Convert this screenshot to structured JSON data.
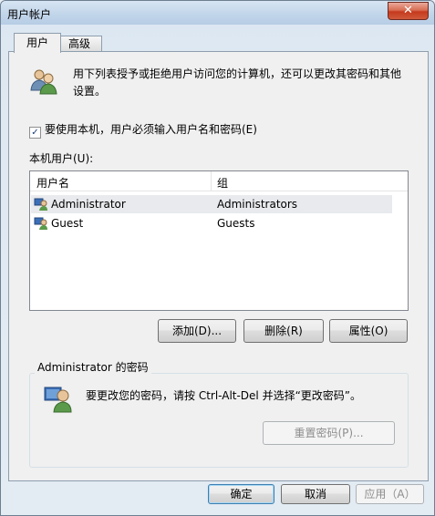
{
  "window": {
    "title": "用户帐户",
    "close_label": "✕"
  },
  "tabs": [
    {
      "label": "用户"
    },
    {
      "label": "高级"
    }
  ],
  "intro_text": "用下列表授予或拒绝用户访问您的计算机，还可以更改其密码和其他设置。",
  "require_login": {
    "checked": true,
    "label": "要使用本机，用户必须输入用户名和密码(E)"
  },
  "local_users_label": "本机用户(U):",
  "users_table": {
    "columns": [
      "用户名",
      "组"
    ],
    "rows": [
      {
        "name": "Administrator",
        "group": "Administrators",
        "selected": true
      },
      {
        "name": "Guest",
        "group": "Guests",
        "selected": false
      }
    ]
  },
  "user_buttons": {
    "add": "添加(D)...",
    "remove": "删除(R)",
    "properties": "属性(O)"
  },
  "password_group": {
    "title": "Administrator 的密码",
    "text": "要更改您的密码，请按 Ctrl-Alt-Del 并选择“更改密码”。",
    "reset_button": "重置密码(P)..."
  },
  "dialog_buttons": {
    "ok": "确定",
    "cancel": "取消",
    "apply": "应用（A）"
  },
  "icons": {
    "users": "users-icon",
    "user_row": "user-icon",
    "password": "password-user-icon"
  }
}
